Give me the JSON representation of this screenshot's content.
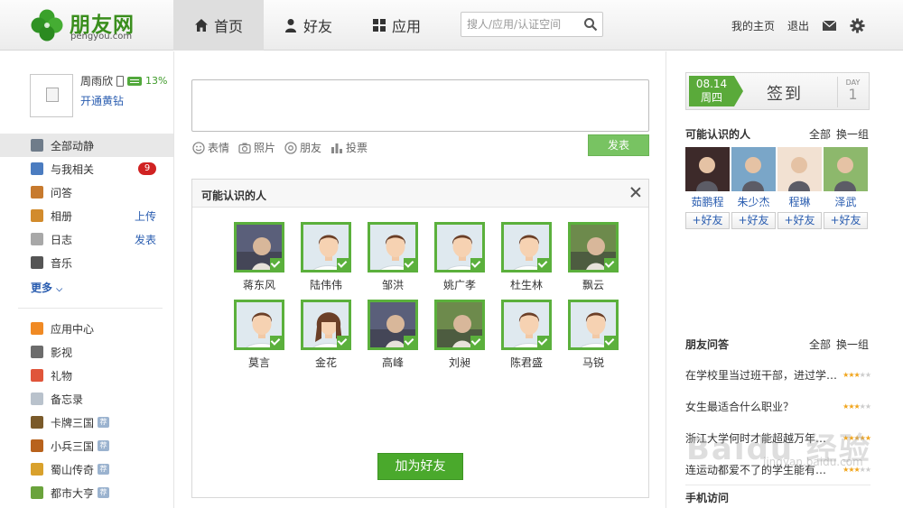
{
  "brand": {
    "name": "朋友网",
    "domain": "pengyou.com",
    "accent": "#3a8e1d"
  },
  "nav": {
    "items": [
      {
        "label": "首页",
        "icon": "home-icon",
        "active": true
      },
      {
        "label": "好友",
        "icon": "person-icon",
        "active": false
      },
      {
        "label": "应用",
        "icon": "grid-icon",
        "active": false
      }
    ]
  },
  "search": {
    "placeholder": "搜人/应用/认证空间"
  },
  "top_right": {
    "home": "我的主页",
    "logout": "退出"
  },
  "profile": {
    "name": "周雨欣",
    "percent": "13%",
    "vip_link": "开通黄钻"
  },
  "menu": {
    "items": [
      {
        "label": "全部动静",
        "active": true
      },
      {
        "label": "与我相关",
        "badge": "9"
      },
      {
        "label": "问答"
      },
      {
        "label": "相册",
        "extra": "上传"
      },
      {
        "label": "日志",
        "extra": "发表"
      },
      {
        "label": "音乐"
      }
    ],
    "more": "更多"
  },
  "apps": {
    "items": [
      {
        "label": "应用中心"
      },
      {
        "label": "影视"
      },
      {
        "label": "礼物"
      },
      {
        "label": "备忘录"
      },
      {
        "label": "卡牌三国",
        "tag": "荐"
      },
      {
        "label": "小兵三国",
        "tag": "荐"
      },
      {
        "label": "蜀山传奇",
        "tag": "荐"
      },
      {
        "label": "都市大亨",
        "tag": "荐"
      }
    ]
  },
  "composer": {
    "tools": [
      "表情",
      "照片",
      "朋友",
      "投票"
    ],
    "post_label": "发表"
  },
  "pymk": {
    "title": "可能认识的人",
    "people": [
      {
        "name": "蒋东风",
        "photo": true
      },
      {
        "name": "陆伟伟",
        "photo": false
      },
      {
        "name": "邹洪",
        "photo": false
      },
      {
        "name": "姚广孝",
        "photo": false
      },
      {
        "name": "杜生林",
        "photo": false
      },
      {
        "name": "飘云",
        "photo": true
      },
      {
        "name": "莫言",
        "photo": false
      },
      {
        "name": "金花",
        "photo": false,
        "female": true
      },
      {
        "name": "高峰",
        "photo": true
      },
      {
        "name": "刘昶",
        "photo": true
      },
      {
        "name": "陈君盛",
        "photo": false
      },
      {
        "name": "马锐",
        "photo": false
      }
    ],
    "add_button": "加为好友"
  },
  "checkin": {
    "date": "08.14",
    "weekday": "周四",
    "label": "签到",
    "day_caption": "DAY",
    "day_value": "1"
  },
  "right_people": {
    "title": "可能认识的人",
    "links": [
      "全部",
      "换一组"
    ],
    "people": [
      {
        "name": "茹鹏程",
        "add": "+好友"
      },
      {
        "name": "朱少杰",
        "add": "+好友"
      },
      {
        "name": "程琳",
        "add": "+好友"
      },
      {
        "name": "泽武",
        "add": "+好友"
      }
    ]
  },
  "qa": {
    "title": "朋友问答",
    "links": [
      "全部",
      "换一组"
    ],
    "items": [
      {
        "text": "在学校里当过班干部，进过学…",
        "rating": 3
      },
      {
        "text": "女生最适合什么职业？",
        "rating": 3
      },
      {
        "text": "浙江大学何时才能超越万年…",
        "rating": 5
      },
      {
        "text": "连运动都爱不了的学生能有…",
        "rating": 3
      }
    ]
  },
  "phone_visit": {
    "title": "手机访问"
  },
  "watermark": {
    "text": "Baidu 经验",
    "sub": "jingyan.baidu.com"
  }
}
